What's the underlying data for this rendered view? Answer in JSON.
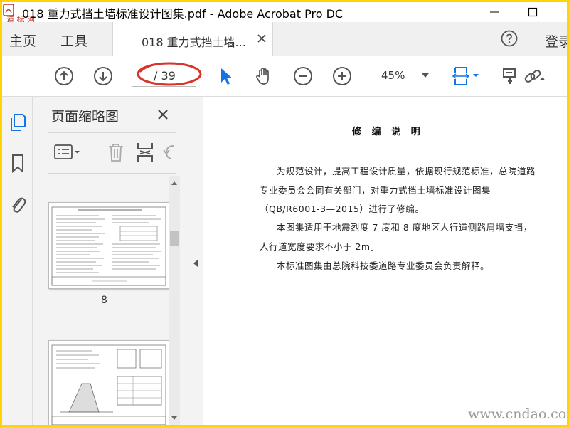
{
  "window": {
    "title": "018 重力式挡土墙标准设计图集.pdf - Adobe Acrobat Pro DC",
    "logo_text": "道 标 网"
  },
  "nav_tabs": [
    "主页",
    "工具"
  ],
  "document_tab": {
    "label": "018 重力式挡土墙..."
  },
  "login_label": "登录",
  "toolbar": {
    "page_current": "",
    "page_total": "/ 39",
    "zoom": "45%"
  },
  "thumbnails_panel": {
    "title": "页面缩略图",
    "pages": [
      {
        "label": "8"
      },
      {
        "label": ""
      }
    ]
  },
  "document": {
    "heading": "修 编 说 明",
    "paragraphs": [
      "为规范设计，提高工程设计质量，依据现行规范标准，总院道路",
      "专业委员会会同有关部门，对重力式挡土墙标准设计图集",
      "（QB/R6001-3—2015）进行了修编。",
      "本图集适用于地震烈度 7 度和 8 度地区人行道侧路肩墙支挡，",
      "人行道宽度要求不小于 2m。",
      "本标准图集由总院科技委道路专业委员会负责解释。"
    ]
  },
  "watermark": "www.cndao.com",
  "colors": {
    "frame_border": "#ffd400",
    "accent_blue": "#1473e6",
    "annotation_red": "#d9342b",
    "rail_bg": "#f3f3f3"
  },
  "icons": {
    "toolbar": [
      "prev-page-icon",
      "next-page-icon",
      "select-arrow-icon",
      "hand-icon",
      "zoom-out-icon",
      "zoom-in-icon",
      "scroll-mode-icon",
      "comment-icon",
      "link-icon"
    ],
    "rail": [
      "page-thumbnails-icon",
      "bookmark-icon",
      "attachment-icon"
    ],
    "panel_tools": [
      "options-menu-icon",
      "delete-icon",
      "rotate-fit-icon",
      "undo-icon"
    ]
  }
}
